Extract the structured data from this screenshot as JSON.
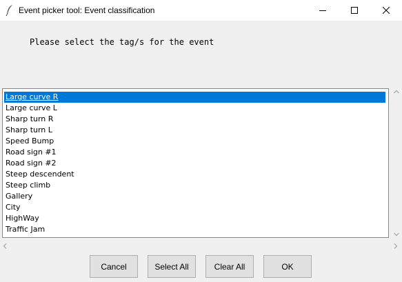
{
  "window": {
    "title": "Event picker tool: Event classification",
    "icon": "feather-icon",
    "controls": [
      "minimize-icon",
      "maximize-icon",
      "close-icon"
    ]
  },
  "prompt": "Please select the tag/s for the event",
  "listbox": {
    "selected_index": 0,
    "items": [
      "Large curve R",
      "Large curve L",
      "Sharp turn R",
      "Sharp turn L",
      "Speed Bump",
      "Road sign #1",
      "Road sign #2",
      "Steep descendent",
      "Steep climb",
      "Gallery",
      "City",
      "HighWay",
      "Traffic Jam"
    ]
  },
  "buttons": {
    "cancel": "Cancel",
    "select_all": "Select All",
    "clear_all": "Clear All",
    "ok": "OK"
  },
  "colors": {
    "selection": "#0078d7",
    "window_bg": "#f0f0f0",
    "button_bg": "#e1e1e1"
  }
}
